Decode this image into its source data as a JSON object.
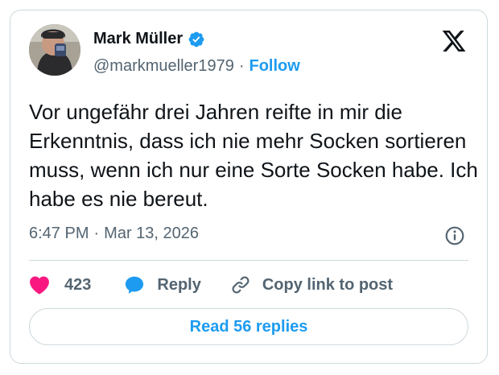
{
  "author": {
    "name": "Mark Müller",
    "handle": "@markmueller1979",
    "separator": "·",
    "follow_label": "Follow",
    "avatar_icon": "person-drinking-avatar"
  },
  "tweet": {
    "text": "Vor ungefähr drei Jahren reifte in mir die Erkenntnis, dass ich nie mehr Socken sortieren muss, wenn ich nur eine Sorte Socken habe. Ich habe es nie bereut.",
    "time": "6:47 PM",
    "separator": "·",
    "date": "Mar 13, 2026"
  },
  "actions": {
    "like_count": "423",
    "reply_label": "Reply",
    "copy_label": "Copy link to post"
  },
  "read_replies_label": "Read 56 replies",
  "icons": {
    "verified": "verified-badge-icon",
    "logo": "x-logo-icon",
    "info": "info-icon",
    "like": "heart-icon",
    "reply": "speech-bubble-icon",
    "copy": "link-icon"
  },
  "colors": {
    "accent": "#1d9bf0",
    "heart": "#f91880",
    "text": "#0f1419",
    "muted": "#536471",
    "border": "#cfd9de"
  }
}
